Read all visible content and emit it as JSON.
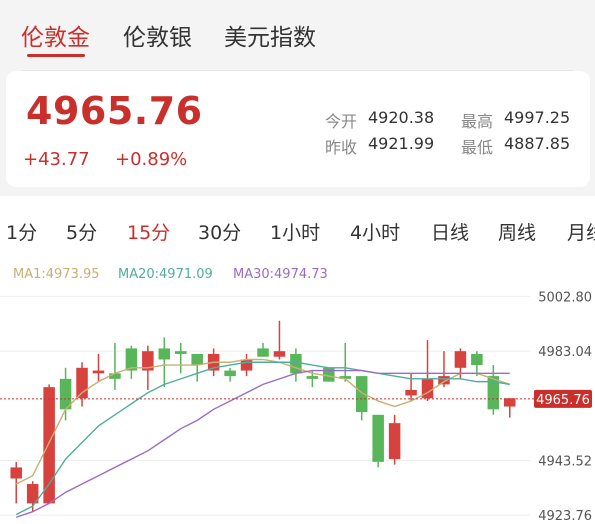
{
  "tabs": [
    {
      "label": "伦敦金",
      "active": true
    },
    {
      "label": "伦敦银",
      "active": false
    },
    {
      "label": "美元指数",
      "active": false
    }
  ],
  "quote": {
    "price": "4965.76",
    "change": "+43.77",
    "change_pct": "+0.89%",
    "open_label": "今开",
    "open": "4920.38",
    "high_label": "最高",
    "high": "4997.25",
    "prev_close_label": "昨收",
    "prev_close": "4921.99",
    "low_label": "最低",
    "low": "4887.85"
  },
  "periods": [
    {
      "label": "1分",
      "active": false
    },
    {
      "label": "5分",
      "active": false
    },
    {
      "label": "15分",
      "active": true
    },
    {
      "label": "30分",
      "active": false
    },
    {
      "label": "1小时",
      "active": false
    },
    {
      "label": "4小时",
      "active": false
    },
    {
      "label": "日线",
      "active": false
    },
    {
      "label": "周线",
      "active": false
    },
    {
      "label": "月线",
      "active": false
    }
  ],
  "ma": {
    "ma1": "MA1:4973.95",
    "ma1_color": "#c8b071",
    "ma20": "MA20:4971.09",
    "ma20_color": "#4fae9b",
    "ma30": "MA30:4974.73",
    "ma30_color": "#9b6cc7"
  },
  "colors": {
    "up": "#d7423f",
    "down": "#58b55a",
    "accent": "#c9302c"
  },
  "chart_data": {
    "type": "candlestick",
    "y_ticks": [
      "5002.80",
      "4983.04",
      "4943.52",
      "4923.76"
    ],
    "current_price_label": "4965.76",
    "current_price": 4965.76,
    "ylim": [
      4923.76,
      5002.8
    ],
    "candles": [
      {
        "o": 4937,
        "h": 4943,
        "l": 4928,
        "c": 4941
      },
      {
        "o": 4928,
        "h": 4936,
        "l": 4925,
        "c": 4935
      },
      {
        "o": 4928,
        "h": 4971,
        "l": 4928,
        "c": 4970
      },
      {
        "o": 4973,
        "h": 4977,
        "l": 4958,
        "c": 4962
      },
      {
        "o": 4966,
        "h": 4979,
        "l": 4963,
        "c": 4977
      },
      {
        "o": 4975,
        "h": 4982,
        "l": 4972,
        "c": 4976
      },
      {
        "o": 4975,
        "h": 4986,
        "l": 4969,
        "c": 4973
      },
      {
        "o": 4984,
        "h": 4985,
        "l": 4973,
        "c": 4976
      },
      {
        "o": 4976,
        "h": 4985,
        "l": 4969,
        "c": 4983
      },
      {
        "o": 4984,
        "h": 4988,
        "l": 4970,
        "c": 4980
      },
      {
        "o": 4983,
        "h": 4986,
        "l": 4975,
        "c": 4982
      },
      {
        "o": 4982,
        "h": 4982,
        "l": 4972,
        "c": 4978
      },
      {
        "o": 4976,
        "h": 4984,
        "l": 4974,
        "c": 4982
      },
      {
        "o": 4976,
        "h": 4977,
        "l": 4972,
        "c": 4974
      },
      {
        "o": 4976,
        "h": 4982,
        "l": 4974,
        "c": 4980
      },
      {
        "o": 4984,
        "h": 4986,
        "l": 4981,
        "c": 4981
      },
      {
        "o": 4981,
        "h": 4994,
        "l": 4980,
        "c": 4983
      },
      {
        "o": 4982,
        "h": 4984,
        "l": 4972,
        "c": 4975
      },
      {
        "o": 4974,
        "h": 4976,
        "l": 4970,
        "c": 4973
      },
      {
        "o": 4977,
        "h": 4977,
        "l": 4972,
        "c": 4972
      },
      {
        "o": 4974,
        "h": 4986,
        "l": 4972,
        "c": 4973
      },
      {
        "o": 4974,
        "h": 4974,
        "l": 4958,
        "c": 4961
      },
      {
        "o": 4960,
        "h": 4960,
        "l": 4941,
        "c": 4943
      },
      {
        "o": 4944,
        "h": 4960,
        "l": 4942,
        "c": 4957
      },
      {
        "o": 4967,
        "h": 4975,
        "l": 4965,
        "c": 4969
      },
      {
        "o": 4966,
        "h": 4987,
        "l": 4965,
        "c": 4973
      },
      {
        "o": 4971,
        "h": 4983,
        "l": 4970,
        "c": 4974
      },
      {
        "o": 4977,
        "h": 4984,
        "l": 4973,
        "c": 4983
      },
      {
        "o": 4982,
        "h": 4983,
        "l": 4974,
        "c": 4978
      },
      {
        "o": 4974,
        "h": 4978,
        "l": 4960,
        "c": 4962
      },
      {
        "o": 4963,
        "h": 4965,
        "l": 4959,
        "c": 4966
      }
    ],
    "ma1": [
      4935,
      4938,
      4950,
      4962,
      4968,
      4972,
      4975,
      4977,
      4977,
      4978,
      4978,
      4978,
      4979,
      4979,
      4980,
      4980,
      4979,
      4977,
      4975,
      4974,
      4973,
      4968,
      4965,
      4963,
      4965,
      4968,
      4972,
      4975,
      4975,
      4973,
      4971
    ],
    "ma20": [
      4924,
      4927,
      4935,
      4944,
      4950,
      4956,
      4960,
      4964,
      4968,
      4971,
      4973,
      4975,
      4977,
      4978,
      4979,
      4979,
      4979,
      4979,
      4978,
      4977,
      4977,
      4976,
      4975,
      4974,
      4973,
      4973,
      4973,
      4973,
      4972,
      4972,
      4971
    ],
    "ma30": [
      4923,
      4925,
      4928,
      4932,
      4935,
      4938,
      4941,
      4944,
      4947,
      4951,
      4955,
      4958,
      4962,
      4965,
      4968,
      4971,
      4973,
      4975,
      4976,
      4976,
      4976,
      4976,
      4975,
      4975,
      4975,
      4975,
      4975,
      4975,
      4975,
      4975,
      4975
    ]
  }
}
